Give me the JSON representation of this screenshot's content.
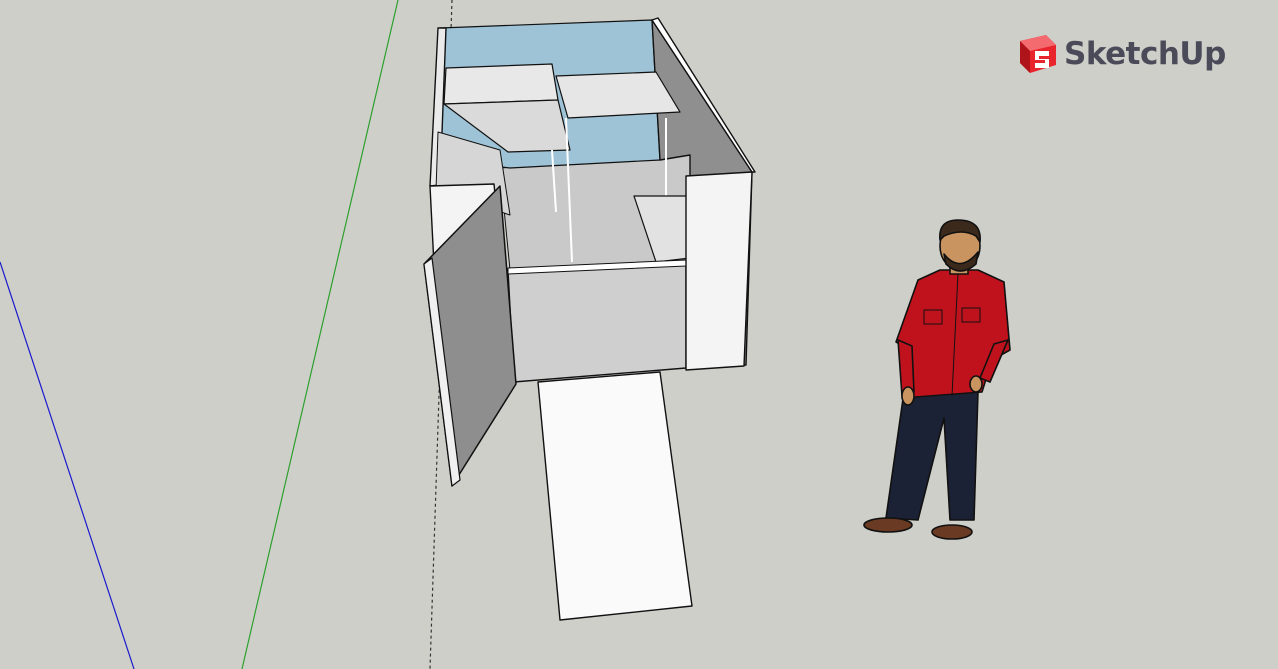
{
  "app": {
    "logo_text": "SketchUp",
    "logo_icon": "sketchup-logo-icon"
  },
  "viewport": {
    "background_color": "#cfcfca",
    "axis_colors": {
      "green_axis": "#2ca02c",
      "blue_axis": "#1a1acc",
      "red_axis_dashed": "#222222"
    }
  },
  "model": {
    "object": "cargo-van-interior-model",
    "interior_window_color": "#9ec3d6",
    "wall_color": "#f4f4f4",
    "floor_color": "#c9c9c9"
  },
  "figure": {
    "object": "scale-figure-person",
    "shirt_color": "#c0121c",
    "pants_color": "#1c2236"
  }
}
